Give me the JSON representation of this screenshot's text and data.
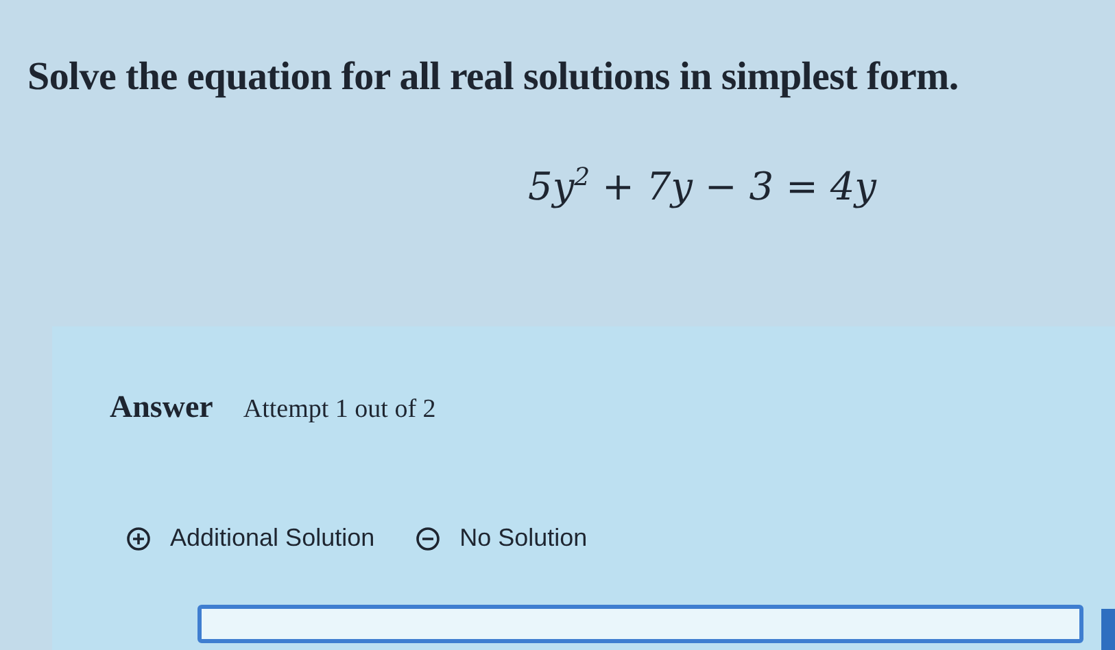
{
  "question": {
    "prompt": "Solve the equation for all real solutions in simplest form.",
    "equation": "5y$^{2}$ + 7y − 3 = 4y"
  },
  "answer": {
    "heading": "Answer",
    "attempt": "Attempt 1 out of 2",
    "actions": [
      {
        "kind": "add",
        "label": "Additional Solution"
      },
      {
        "kind": "remove",
        "label": "No Solution"
      }
    ]
  }
}
